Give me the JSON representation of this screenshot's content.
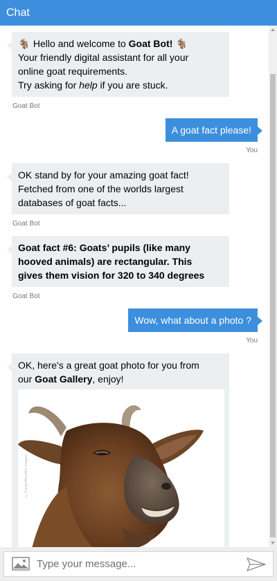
{
  "header": {
    "title": "Chat"
  },
  "messages": {
    "m1": {
      "emoji": "🐐",
      "greeting_prefix": "Hello and welcome to ",
      "greeting_bold": "Goat Bot!",
      "line2": "Your friendly digital assistant for all your",
      "line3": "online goat requirements.",
      "line4_prefix": "Try asking for ",
      "line4_italic": "help",
      "line4_suffix": " if you are stuck.",
      "sender": "Goat Bot"
    },
    "m2": {
      "text": "A goat fact please!",
      "sender": "You"
    },
    "m3": {
      "lines": [
        "OK stand by for your amazing goat fact!",
        "Fetched from one of the worlds largest",
        "databases of goat facts..."
      ],
      "sender": "Goat Bot"
    },
    "m4": {
      "lines": [
        "Goat fact #6: Goats’ pupils (like many",
        "hooved animals) are rectangular. This",
        "gives them vision for 320 to 340 degrees"
      ],
      "sender": "Goat Bot"
    },
    "m5": {
      "text": "Wow, what about a photo ?",
      "sender": "You"
    },
    "m6": {
      "line1": "OK, here's a great goat photo for you from",
      "line2_prefix": "our ",
      "line2_bold": "Goat Gallery",
      "line2_suffix": ", enjoy!",
      "photo_credit": "©Zoonar/Mauritius Images"
    }
  },
  "composer": {
    "placeholder": "Type your message..."
  },
  "colors": {
    "accent": "#3d8fdd",
    "bot_bubble": "#eceff1"
  }
}
